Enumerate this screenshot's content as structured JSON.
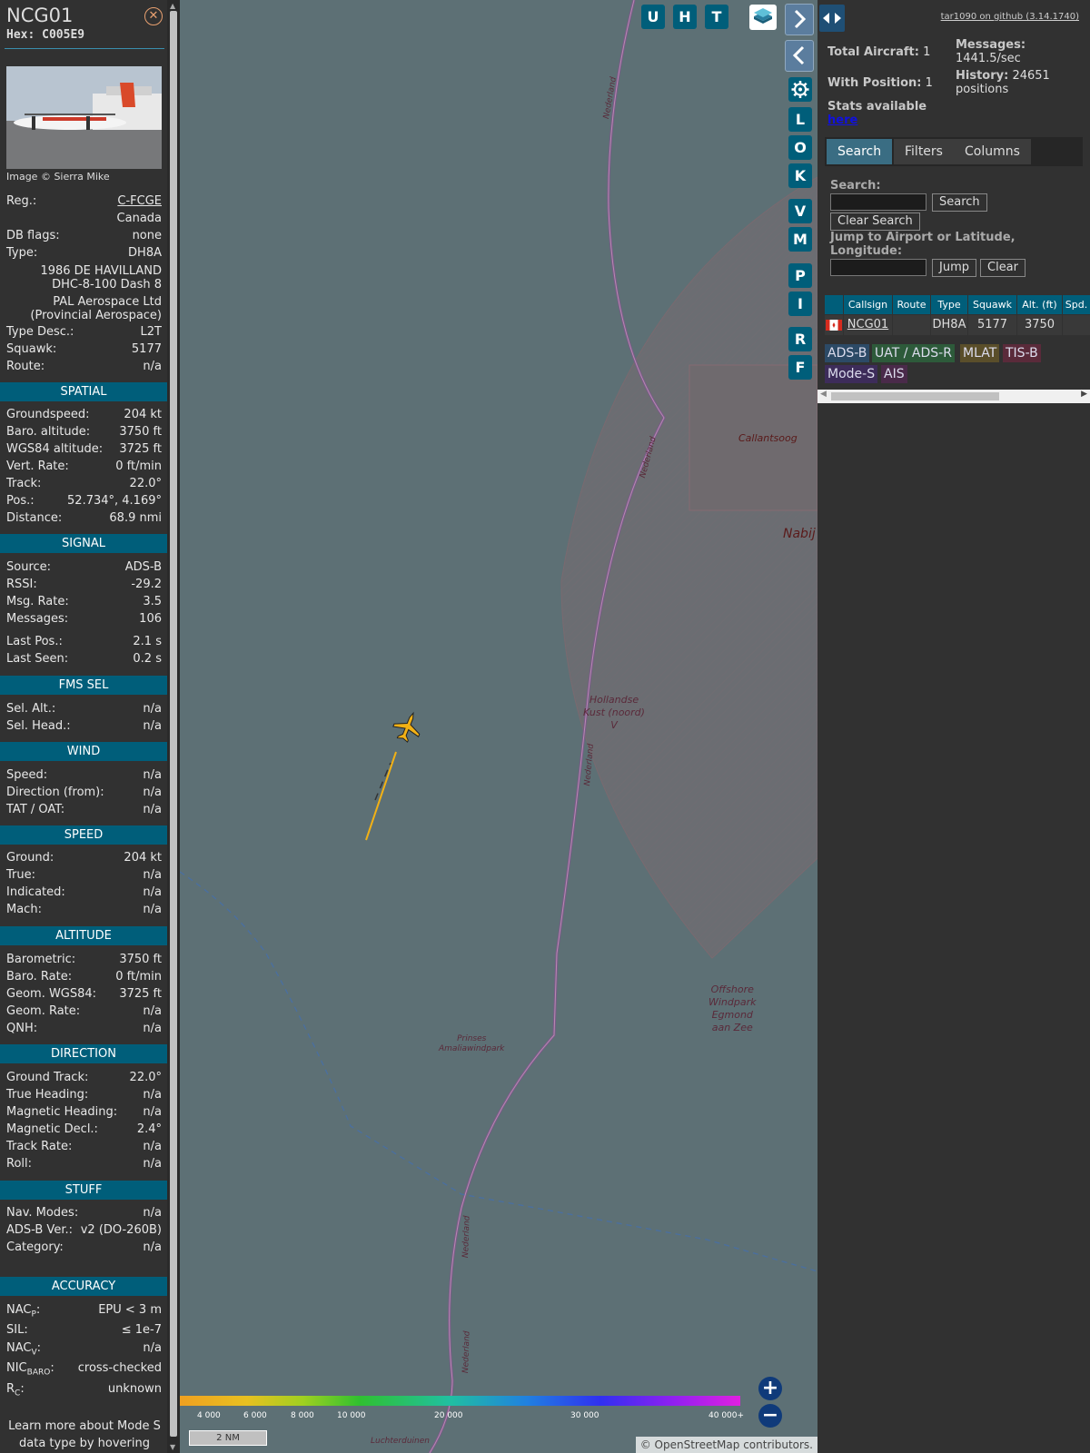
{
  "aircraft": {
    "callsign": "NCG01",
    "hex": "Hex: C005E9",
    "photo_credit": "Image © Sierra Mike",
    "reg_label": "Reg.:",
    "reg": "C-FCGE",
    "country": "Canada",
    "db_flags_label": "DB flags:",
    "db_flags": "none",
    "type_label": "Type:",
    "type": "DH8A",
    "full_type_1": "1986 DE HAVILLAND",
    "full_type_2": "DHC-8-100 Dash 8",
    "owner_1": "PAL Aerospace Ltd",
    "owner_2": "(Provincial Aerospace)",
    "type_desc_label": "Type Desc.:",
    "type_desc": "L2T",
    "squawk_label": "Squawk:",
    "squawk": "5177",
    "route_label": "Route:",
    "route": "n/a"
  },
  "sections": {
    "spatial": "SPATIAL",
    "signal": "SIGNAL",
    "fms_sel": "FMS SEL",
    "wind": "WIND",
    "speed": "SPEED",
    "altitude": "ALTITUDE",
    "direction": "DIRECTION",
    "stuff": "STUFF",
    "accuracy": "ACCURACY"
  },
  "spatial": [
    {
      "k": "Groundspeed:",
      "v": "204 kt"
    },
    {
      "k": "Baro. altitude:",
      "v": "3750 ft"
    },
    {
      "k": "WGS84 altitude:",
      "v": "3725 ft"
    },
    {
      "k": "Vert. Rate:",
      "v": "0 ft/min"
    },
    {
      "k": "Track:",
      "v": "22.0°"
    },
    {
      "k": "Pos.:",
      "v": "52.734°, 4.169°"
    },
    {
      "k": "Distance:",
      "v": "68.9 nmi"
    }
  ],
  "signal": [
    {
      "k": "Source:",
      "v": "ADS-B"
    },
    {
      "k": "RSSI:",
      "v": "-29.2"
    },
    {
      "k": "Msg. Rate:",
      "v": "3.5"
    },
    {
      "k": "Messages:",
      "v": "106"
    },
    {
      "k": "Last Pos.:",
      "v": "2.1 s"
    },
    {
      "k": "Last Seen:",
      "v": "0.2 s"
    }
  ],
  "fms": [
    {
      "k": "Sel. Alt.:",
      "v": "n/a"
    },
    {
      "k": "Sel. Head.:",
      "v": "n/a"
    }
  ],
  "wind": [
    {
      "k": "Speed:",
      "v": "n/a"
    },
    {
      "k": "Direction (from):",
      "v": "n/a"
    },
    {
      "k": "TAT / OAT:",
      "v": "n/a"
    }
  ],
  "speed": [
    {
      "k": "Ground:",
      "v": "204 kt"
    },
    {
      "k": "True:",
      "v": "n/a"
    },
    {
      "k": "Indicated:",
      "v": "n/a"
    },
    {
      "k": "Mach:",
      "v": "n/a"
    }
  ],
  "altitude": [
    {
      "k": "Barometric:",
      "v": "3750 ft"
    },
    {
      "k": "Baro. Rate:",
      "v": "0 ft/min"
    },
    {
      "k": "Geom. WGS84:",
      "v": "3725 ft"
    },
    {
      "k": "Geom. Rate:",
      "v": "n/a"
    },
    {
      "k": "QNH:",
      "v": "n/a"
    }
  ],
  "direction": [
    {
      "k": "Ground Track:",
      "v": "22.0°"
    },
    {
      "k": "True Heading:",
      "v": "n/a"
    },
    {
      "k": "Magnetic Heading:",
      "v": "n/a"
    },
    {
      "k": "Magnetic Decl.:",
      "v": "2.4°"
    },
    {
      "k": "Track Rate:",
      "v": "n/a"
    },
    {
      "k": "Roll:",
      "v": "n/a"
    }
  ],
  "stuff": [
    {
      "k": "Nav. Modes:",
      "v": "n/a"
    },
    {
      "k": "ADS-B Ver.:",
      "v": "v2 (DO-260B)"
    },
    {
      "k": "Category:",
      "v": "n/a"
    }
  ],
  "accuracy": {
    "nacp_label": "NAC",
    "nacp_sub": "P",
    "nacp": "EPU < 3 m",
    "sil_label": "SIL:",
    "sil": "≤ 1e-7",
    "nacv_label": "NAC",
    "nacv_sub": "V",
    "nacv": "n/a",
    "nicbaro_label": "NIC",
    "nicbaro_sub": "BARO",
    "nicbaro": "cross-checked",
    "rc_label": "R",
    "rc_sub": "C",
    "rc": "unknown"
  },
  "learn_more": "Learn more about Mode S data type by hovering over",
  "map": {
    "buttons_top": [
      "U",
      "H",
      "T"
    ],
    "buttons_side": [
      "L",
      "O",
      "K",
      "V",
      "M",
      "P",
      "I",
      "R",
      "F"
    ],
    "labels": {
      "callantsoog": "Callantsoog",
      "nabij": "Nabij",
      "hollandse_1": "Hollandse",
      "hollandse_2": "Kust (noord)",
      "hollandse_3": "V",
      "offshore_1": "Offshore",
      "offshore_2": "Windpark",
      "offshore_3": "Egmond",
      "offshore_4": "aan Zee",
      "prinses_1": "Prinses",
      "prinses_2": "Amaliawindpark",
      "luchterduinen": "Luchterduinen",
      "nederland": "Nederland"
    },
    "alt_scale": [
      "4 000",
      "6 000",
      "8 000",
      "10 000",
      "20 000",
      "30 000",
      "40 000+"
    ],
    "scale_label": "2 NM",
    "attribution_1": "© ",
    "attribution_link": "OpenStreetMap",
    "attribution_2": " contributors.",
    "zoom_in": "+",
    "zoom_out": "−"
  },
  "right": {
    "github": "tar1090 on github (3.14.1740)",
    "total_label": "Total Aircraft:",
    "total": "1",
    "with_pos_label": "With Position:",
    "with_pos": "1",
    "stats_label": "Stats available",
    "stats_link": "here",
    "messages_label": "Messages:",
    "messages": "1441.5/sec",
    "history_label": "History:",
    "history_count": "24651",
    "history_unit": "positions",
    "tabs": [
      "Search",
      "Filters",
      "Columns"
    ],
    "search_label": "Search:",
    "search_btn": "Search",
    "clear_search_btn": "Clear Search",
    "jump_label_1": "Jump to Airport or Latitude,",
    "jump_label_2": "Longitude:",
    "jump_btn": "Jump",
    "clear_btn": "Clear",
    "columns": [
      "Callsign",
      "Route",
      "Type",
      "Squawk",
      "Alt. (ft)",
      "Spd."
    ],
    "row": {
      "callsign": "NCG01",
      "route": "",
      "type": "DH8A",
      "squawk": "5177",
      "alt": "3750"
    },
    "source_tags": [
      "ADS-B",
      "UAT / ADS-R",
      "MLAT",
      "TIS-B",
      "Mode-S",
      "AIS"
    ]
  },
  "colors": {
    "section_header": "#005e7a",
    "map_sea": "#5d7075",
    "aircraft": "#f2b115"
  }
}
